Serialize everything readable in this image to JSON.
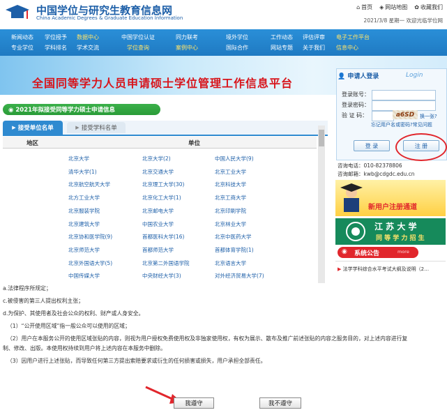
{
  "header": {
    "title": "中国学位与研究生教育信息网",
    "subtitle": "China Academic Degrees & Graduate Education Information",
    "links": [
      {
        "label": "首页",
        "icon": "home-icon"
      },
      {
        "label": "网站地图",
        "icon": "sitemap-icon"
      },
      {
        "label": "收藏我们",
        "icon": "favorite-icon"
      }
    ],
    "date_line": "2021/3/8 星期一  欢迎光临学位网"
  },
  "nav": {
    "columns": [
      [
        "新闻动态",
        "专业学位"
      ],
      [
        "学位授予",
        "学科排名"
      ],
      [
        "数据中心",
        "学术交流"
      ],
      [
        "中国学位认证",
        "学位查询"
      ],
      [
        "同力联考",
        "案例中心"
      ],
      [
        "境外学位",
        "国际合作"
      ],
      [
        "工作动态",
        "网站专题"
      ],
      [
        "评估评审",
        "关于我们"
      ],
      [
        "电子工作平台",
        "信息中心"
      ]
    ]
  },
  "banner": {
    "title": "全国同等学力人员申请硕士学位管理工作信息平台"
  },
  "info_bar": "2021年拟接受同等学力硕士申请信息",
  "tabs": [
    {
      "label": "接受单位名单"
    },
    {
      "label": "接受学科名单"
    }
  ],
  "table": {
    "headers": [
      "地区",
      "单位"
    ],
    "rows": [
      [
        "北京大学",
        "北京大学(2)",
        "中国人民大学(9)"
      ],
      [
        "清华大学(1)",
        "北京交通大学",
        "北京工业大学"
      ],
      [
        "北京航空航天大学",
        "北京理工大学(30)",
        "北京科技大学"
      ],
      [
        "北方工业大学",
        "北京化工大学(1)",
        "北京工商大学"
      ],
      [
        "北京服装学院",
        "北京邮电大学",
        "北京印刷学院"
      ],
      [
        "北京建筑大学",
        "中国农业大学",
        "北京林业大学"
      ],
      [
        "北京协和医学院(9)",
        "首都医科大学(16)",
        "北京中医药大学"
      ],
      [
        "北京师范大学",
        "首都师范大学",
        "首都体育学院(1)"
      ],
      [
        "北京外国语大学(5)",
        "北京第二外国语学院",
        "北京语言大学"
      ],
      [
        "中国传媒大学",
        "中央财经大学(3)",
        "对外经济贸易大学(7)"
      ]
    ]
  },
  "login": {
    "title": "申请人登录",
    "title_en": "Login",
    "account_label": "登录账号：",
    "password_label": "登录密码：",
    "captcha_label": "验 证 码：",
    "captcha_text": "a6SD",
    "refresh": "换一张?",
    "forgot": "忘记用户名或密码?常见问题",
    "login_button": "登  录",
    "register_button": "注  册"
  },
  "contact": {
    "phone": "咨询电话：010-82378806",
    "email": "咨询邮箱：kwb@cdgdc.edu.cn"
  },
  "promo": {
    "new_user": "新用户注册通道",
    "jiangsu_name": "江 苏 大 学",
    "jiangsu_sub": "同 等 学 力 招 生"
  },
  "notice": {
    "title": "系统公告",
    "tag": "more",
    "item": "法学学科综合水平考试大纲及说明（2…"
  },
  "terms": [
    "a.法律程序所规定；",
    "c.被侵害的第三人提出权利主张；",
    "d.为保护、其使用者及社会公众的权利、财产或人身安全。",
    "（1）“公开使用区域”指一般公众可以使用的区域；",
    "（2）用户在本服务公开的使用区域张贴的内容，则视为用户授权免费使用权及非独家使用权，有权为展示、散布及推广前述张贴的内容之服务目的，对上述内容进行复",
    "制、修改、出版。本使用权持续到用户将上述内容在本服务中删除。",
    "（3）因用户进行上述张贴，而导致任何第三方提出索赔要求或衍生的任何损害或损失，用户承担全部责任。"
  ],
  "buttons": {
    "agree": "我遵守",
    "disagree": "我不遵守"
  },
  "colors": {
    "nav": "#1f7ac2",
    "banner_title": "#d8141b",
    "link": "#1d5fa8",
    "highlight": "#e1262c"
  }
}
